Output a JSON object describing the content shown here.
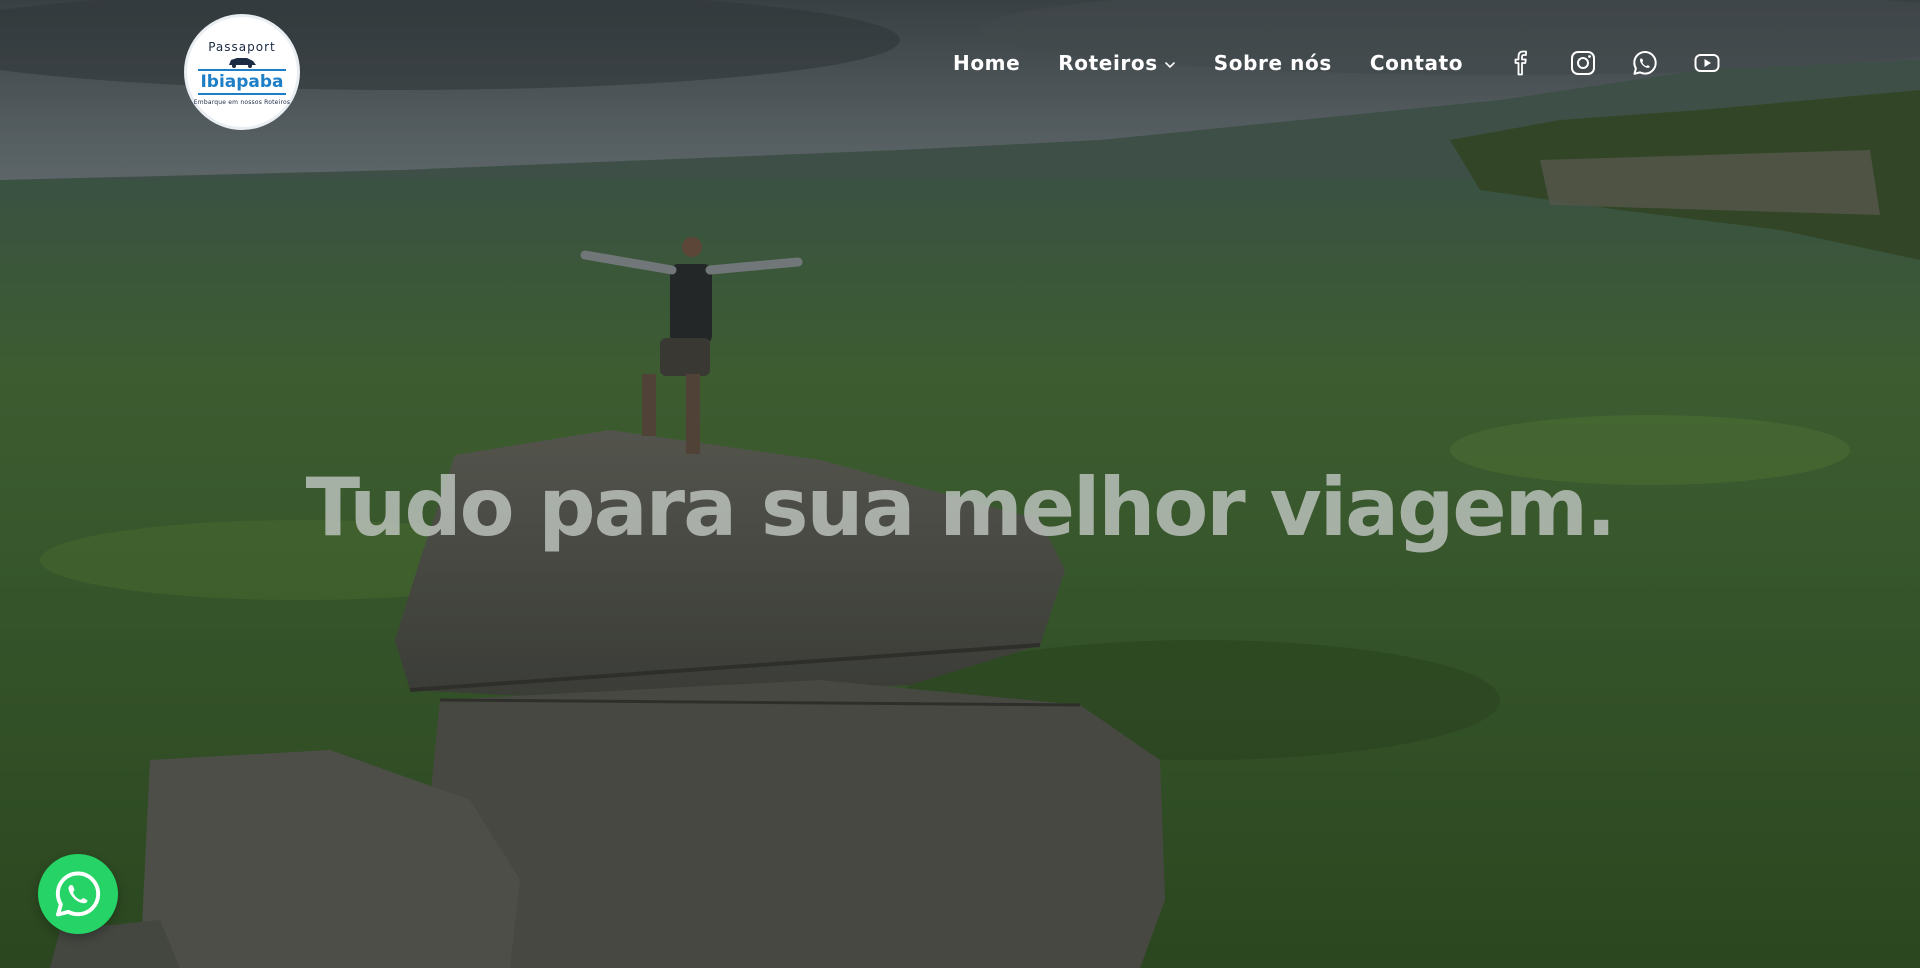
{
  "logo": {
    "top_text": "Passaport",
    "main_text": "Ibiapaba",
    "tagline": "Embarque em nossos Roteiros"
  },
  "nav": {
    "items": [
      {
        "label": "Home"
      },
      {
        "label": "Roteiros",
        "has_dropdown": true
      },
      {
        "label": "Sobre nós"
      },
      {
        "label": "Contato"
      }
    ]
  },
  "socials": [
    {
      "icon": "facebook-icon"
    },
    {
      "icon": "instagram-icon"
    },
    {
      "icon": "whatsapp-icon"
    },
    {
      "icon": "youtube-icon"
    }
  ],
  "hero": {
    "headline": "Tudo para sua melhor viagem."
  },
  "floating_button": {
    "icon": "whatsapp-icon"
  },
  "colors": {
    "nav_text": "#ffffff",
    "logo_blue": "#1e7fc7",
    "whatsapp_green": "#25d366",
    "headline": "#bec4c0"
  }
}
